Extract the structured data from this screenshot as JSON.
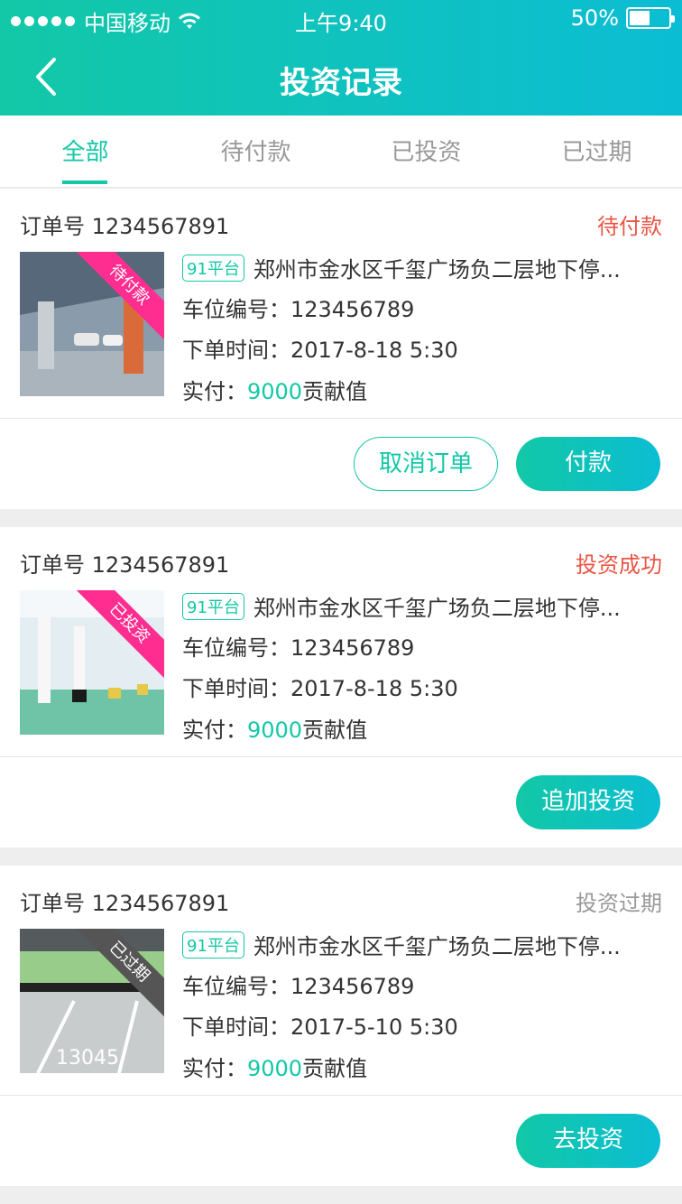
{
  "status_bar": {
    "carrier": "中国移动",
    "time": "上午9:40",
    "battery": "50%"
  },
  "header": {
    "title": "投资记录"
  },
  "tabs": [
    {
      "label": "全部",
      "active": true
    },
    {
      "label": "待付款",
      "active": false
    },
    {
      "label": "已投资",
      "active": false
    },
    {
      "label": "已过期",
      "active": false
    }
  ],
  "labels": {
    "slot": "车位编号：",
    "time": "下单时间：",
    "paid": "实付：",
    "unit": "贡献值"
  },
  "orders": [
    {
      "order_no": "订单号 1234567891",
      "status": "待付款",
      "status_color": "#ea5544",
      "ribbon": "待付款",
      "ribbon_color": "#ff2d8f",
      "platform": "91平台",
      "address": "郑州市金水区千玺广场负二层地下停...",
      "slot": "123456789",
      "time": "2017-8-18 5:30",
      "amount": "9000",
      "buttons": [
        "取消订单",
        "付款"
      ]
    },
    {
      "order_no": "订单号 1234567891",
      "status": "投资成功",
      "status_color": "#ea5544",
      "ribbon": "已投资",
      "ribbon_color": "#ff2d8f",
      "platform": "91平台",
      "address": "郑州市金水区千玺广场负二层地下停...",
      "slot": "123456789",
      "time": "2017-8-18 5:30",
      "amount": "9000",
      "buttons": [
        "追加投资"
      ]
    },
    {
      "order_no": "订单号 1234567891",
      "status": "投资过期",
      "status_color": "#999999",
      "ribbon": "已过期",
      "ribbon_color": "#555555",
      "platform": "91平台",
      "address": "郑州市金水区千玺广场负二层地下停...",
      "slot": "123456789",
      "time": "2017-5-10 5:30",
      "amount": "9000",
      "buttons": [
        "去投资"
      ]
    }
  ]
}
